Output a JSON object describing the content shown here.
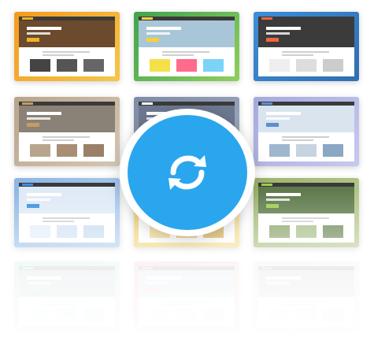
{
  "thumbnails": [
    {
      "name": "template-thumbnail-1",
      "frame": "#f39a1f",
      "frame2": "#f5c64a",
      "hero": "#6b4a2e",
      "accent": "#f3b12a",
      "tiles": [
        "#444",
        "#555",
        "#666"
      ]
    },
    {
      "name": "template-thumbnail-2",
      "frame": "#3fa34d",
      "frame2": "#8fcf5f",
      "hero": "#a9c6d8",
      "accent": "#f3d23a",
      "tiles": [
        "#f4e14a",
        "#ff6b8a",
        "#7bd3f7"
      ]
    },
    {
      "name": "template-thumbnail-3",
      "frame": "#3c8ed8",
      "frame2": "#2f6fb0",
      "hero": "#3b3b3b",
      "accent": "#f0653b",
      "tiles": [
        "#eee",
        "#ddd",
        "#ccc"
      ]
    },
    {
      "name": "template-thumbnail-4",
      "frame": "#b8a48c",
      "frame2": "#d6c7b3",
      "hero": "#8a8276",
      "accent": "#c99a63",
      "tiles": [
        "#b9a58d",
        "#a88f74",
        "#998066"
      ]
    },
    {
      "name": "template-thumbnail-5",
      "frame": "#7d8ca5",
      "frame2": "#9eaac0",
      "hero": "#6c7890",
      "accent": "#ffffff",
      "tiles": [
        "#bbb",
        "#aaa",
        "#999"
      ]
    },
    {
      "name": "template-thumbnail-6",
      "frame": "#a6a9de",
      "frame2": "#c7c9ee",
      "hero": "#d9e4ef",
      "accent": "#5b8fd1",
      "tiles": [
        "#9fb6cf",
        "#c6d3e0",
        "#8aa7c4"
      ]
    },
    {
      "name": "template-thumbnail-7",
      "frame": "#8bb6e6",
      "frame2": "#b4d0f0",
      "hero": "#dfeaf7",
      "accent": "#3d8fe0",
      "tiles": [
        "#e4eef9",
        "#d4e3f5",
        "#c9dcf2"
      ]
    },
    {
      "name": "template-thumbnail-8",
      "frame": "#f0cf6a",
      "frame2": "#f5df95",
      "hero": "#f7e3a4",
      "accent": "#e0a93a",
      "tiles": [
        "#f1d98f",
        "#e9c56d",
        "#dcb354"
      ]
    },
    {
      "name": "template-thumbnail-9",
      "frame": "#9cb46b",
      "frame2": "#bccd93",
      "hero": "#5f7a4c",
      "accent": "#9fcc4d",
      "tiles": [
        "#8aa46a",
        "#a6bd86",
        "#6e8a57"
      ]
    },
    {
      "name": "template-thumbnail-10",
      "frame": "#76c9b8",
      "frame2": "#a6ded2",
      "hero": "#7e9aa2",
      "accent": "#74c4b3",
      "tiles": [
        "#d0e8e2",
        "#c2e0d8",
        "#b5d7cf"
      ]
    },
    {
      "name": "template-thumbnail-11",
      "frame": "#ea7b86",
      "frame2": "#f4a6ae",
      "hero": "#a7bccb",
      "accent": "#ea7b86",
      "tiles": [
        "#e9eff4",
        "#dbe5ec",
        "#cfdbe4"
      ]
    },
    {
      "name": "template-thumbnail-12",
      "frame": "#c9ccd3",
      "frame2": "#dde0e5",
      "hero": "#9aa0aa",
      "accent": "#8f96a3",
      "tiles": [
        "#e7e9ed",
        "#dcdfe5",
        "#d2d6dc"
      ]
    }
  ],
  "overlay": {
    "icon": "sync-icon",
    "color": "#2aa6ee"
  }
}
